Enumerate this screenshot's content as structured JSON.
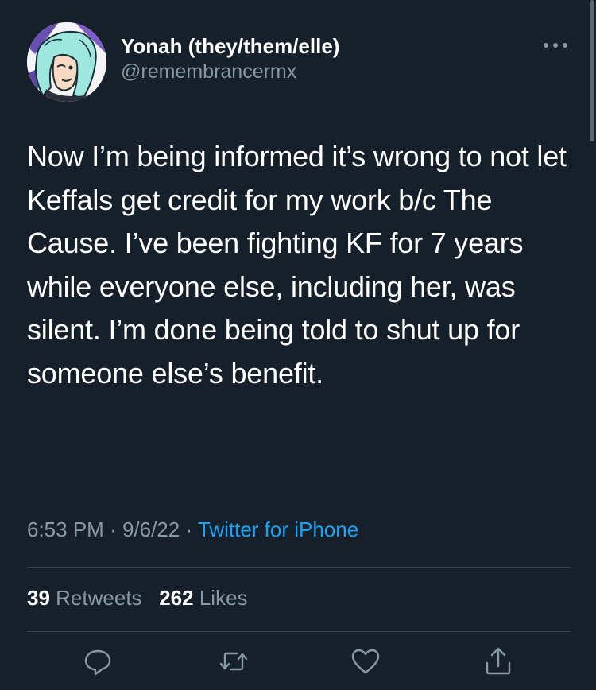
{
  "user": {
    "display_name": "Yonah (they/them/elle)",
    "handle": "@remembrancermx"
  },
  "tweet": {
    "text": "Now I’m being informed it’s wrong to not let Keffals get credit for my work b/c The Cause. I’ve been fighting KF for 7 years while everyone else, including her, was silent. I’m done being told to shut up for someone else’s benefit.",
    "time": "6:53 PM",
    "date": "9/6/22",
    "source": "Twitter for iPhone",
    "separator": " · "
  },
  "stats": {
    "retweets_count": "39",
    "retweets_label": "Retweets",
    "likes_count": "262",
    "likes_label": "Likes"
  },
  "actions": {
    "reply_icon": "reply-icon",
    "retweet_icon": "retweet-icon",
    "like_icon": "heart-icon",
    "share_icon": "share-icon",
    "more_icon": "more-horizontal-icon"
  },
  "colors": {
    "background": "#15202b",
    "text_primary": "#ffffff",
    "text_secondary": "#8899a6",
    "accent": "#1da1f2",
    "divider": "#38444d"
  }
}
